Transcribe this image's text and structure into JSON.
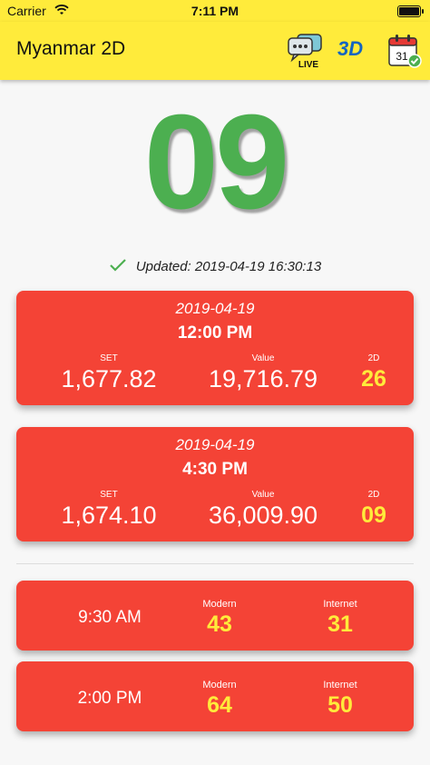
{
  "status_bar": {
    "carrier": "Carrier",
    "time": "7:11 PM"
  },
  "app_bar": {
    "title": "Myanmar 2D",
    "live_label": "LIVE",
    "three_d_label": "3D",
    "calendar_day": "31"
  },
  "main": {
    "big_number": "09",
    "updated_text": "Updated: 2019-04-19 16:30:13"
  },
  "results": [
    {
      "date": "2019-04-19",
      "time": "12:00 PM",
      "set_label": "SET",
      "set_value": "1,677.82",
      "value_label": "Value",
      "value_value": "19,716.79",
      "twod_label": "2D",
      "twod_value": "26"
    },
    {
      "date": "2019-04-19",
      "time": "4:30 PM",
      "set_label": "SET",
      "set_value": "1,674.10",
      "value_label": "Value",
      "value_value": "36,009.90",
      "twod_label": "2D",
      "twod_value": "09"
    }
  ],
  "sessions": [
    {
      "time": "9:30 AM",
      "modern_label": "Modern",
      "modern_value": "43",
      "internet_label": "Internet",
      "internet_value": "31"
    },
    {
      "time": "2:00 PM",
      "modern_label": "Modern",
      "modern_value": "64",
      "internet_label": "Internet",
      "internet_value": "50"
    }
  ],
  "colors": {
    "app_bar": "#ffeb3b",
    "card": "#f44336",
    "big_number": "#4caf50",
    "highlight": "#ffeb3b",
    "three_d": "#1565c0"
  }
}
